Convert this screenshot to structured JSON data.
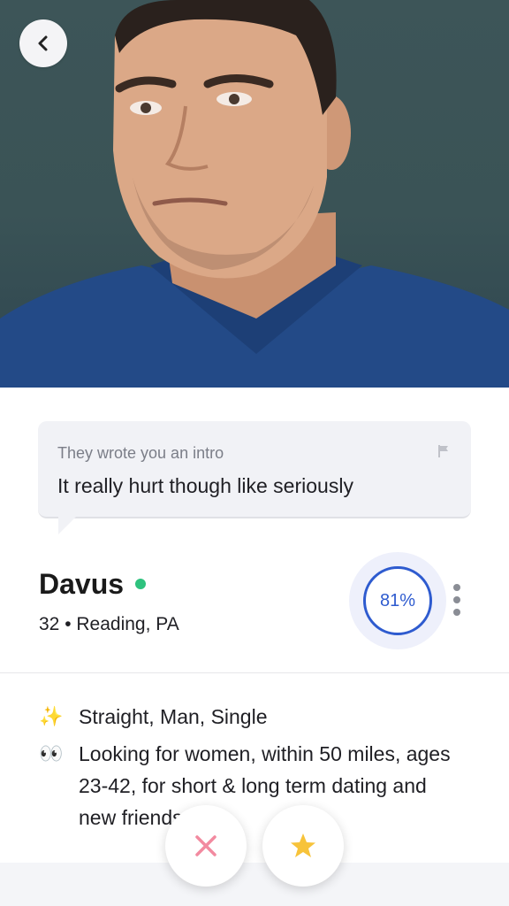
{
  "profile": {
    "photo_alt": "Profile photo",
    "intro_label": "They wrote you an intro",
    "intro_message": "It really hurt though like seriously",
    "name": "Davus",
    "age_location": "32 • Reading, PA",
    "match_percent": "81%"
  },
  "details": [
    {
      "emoji": "✨",
      "text": "Straight, Man, Single"
    },
    {
      "emoji": "👀",
      "text": "Looking for women, within 50 miles, ages 23-42, for short & long term dating and new friends"
    }
  ],
  "icons": {
    "back": "chevron-left-icon",
    "flag": "flag-icon",
    "more": "more-vertical-icon",
    "pass": "close-icon",
    "like": "star-icon"
  },
  "colors": {
    "online": "#2ec27e",
    "match_ring": "#2e5bcf",
    "pass": "#f28aa0",
    "like": "#f7c33a"
  }
}
